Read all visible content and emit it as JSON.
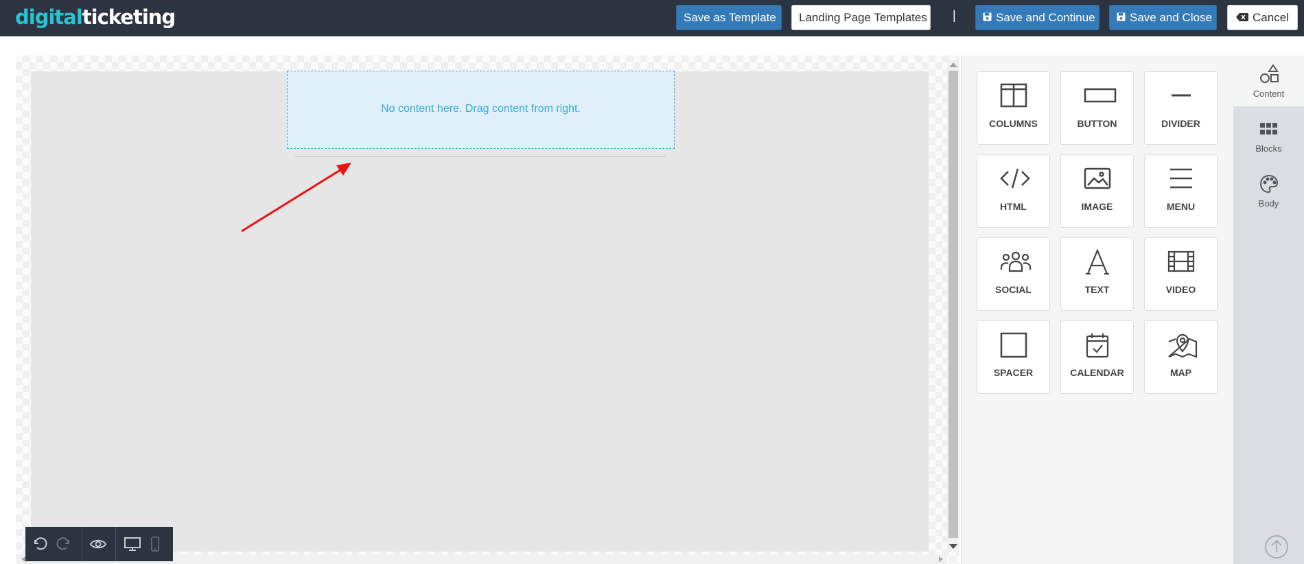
{
  "header": {
    "logo_part1": "digital",
    "logo_part2": "ticketing",
    "save_as_template": "Save as Template",
    "landing_page_templates": "Landing Page Templates",
    "separator": "|",
    "save_and_continue": "Save and Continue",
    "save_and_close": "Save and Close",
    "cancel": "Cancel"
  },
  "canvas": {
    "placeholder": "No content here. Drag content from right."
  },
  "content_tiles": [
    {
      "label": "COLUMNS",
      "icon": "columns-icon"
    },
    {
      "label": "BUTTON",
      "icon": "button-icon"
    },
    {
      "label": "DIVIDER",
      "icon": "divider-icon"
    },
    {
      "label": "HTML",
      "icon": "code-icon"
    },
    {
      "label": "IMAGE",
      "icon": "image-icon"
    },
    {
      "label": "MENU",
      "icon": "menu-icon"
    },
    {
      "label": "SOCIAL",
      "icon": "users-icon"
    },
    {
      "label": "TEXT",
      "icon": "text-icon"
    },
    {
      "label": "VIDEO",
      "icon": "film-icon"
    },
    {
      "label": "SPACER",
      "icon": "square-icon"
    },
    {
      "label": "CALENDAR",
      "icon": "calendar-icon"
    },
    {
      "label": "MAP",
      "icon": "map-pin-icon"
    }
  ],
  "side_tabs": [
    {
      "label": "Content",
      "icon": "shapes-icon",
      "active": true
    },
    {
      "label": "Blocks",
      "icon": "grid-icon",
      "active": false
    },
    {
      "label": "Body",
      "icon": "palette-icon",
      "active": false
    }
  ],
  "colors": {
    "header_bg": "#2b3440",
    "primary_button": "#337ab7",
    "logo_accent": "#28c3d4",
    "dropzone_border": "#3aa9d9",
    "annotation_arrow": "#ee1111"
  }
}
